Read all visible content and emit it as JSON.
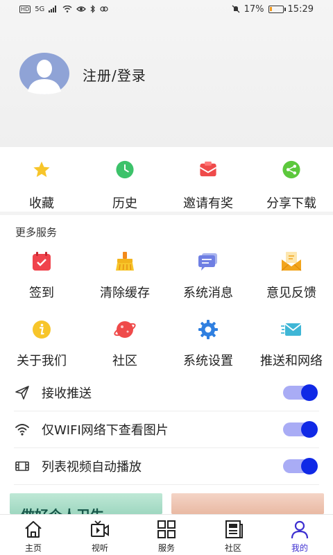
{
  "status_bar": {
    "left": "5G",
    "battery": "17%",
    "time": "15:29",
    "battery_level": 0.17
  },
  "profile": {
    "login_label": "注册/登录",
    "avatar_icon": "user-avatar-icon"
  },
  "quick": [
    {
      "label": "收藏",
      "icon": "star-icon",
      "color": "#f7c52a"
    },
    {
      "label": "历史",
      "icon": "clock-icon",
      "color": "#3cc26a"
    },
    {
      "label": "邀请有奖",
      "icon": "envelope-icon",
      "color": "#ef4a4a"
    },
    {
      "label": "分享下载",
      "icon": "share-icon",
      "color": "#5cc83c"
    }
  ],
  "more": {
    "title": "更多服务",
    "items": [
      {
        "label": "签到",
        "icon": "calendar-icon"
      },
      {
        "label": "清除缓存",
        "icon": "broom-icon"
      },
      {
        "label": "系统消息",
        "icon": "message-icon"
      },
      {
        "label": "意见反馈",
        "icon": "feedback-mail-icon"
      },
      {
        "label": "关于我们",
        "icon": "info-icon"
      },
      {
        "label": "社区",
        "icon": "planet-icon"
      },
      {
        "label": "系统设置",
        "icon": "gear-icon"
      },
      {
        "label": "推送和网络",
        "icon": "push-mail-icon"
      }
    ]
  },
  "settings": [
    {
      "label": "接收推送",
      "icon": "send-icon",
      "on": true
    },
    {
      "label": "仅WIFI网络下查看图片",
      "icon": "wifi-icon",
      "on": true
    },
    {
      "label": "列表视频自动播放",
      "icon": "film-icon",
      "on": true
    }
  ],
  "banner_a_text": "做好个人卫生",
  "tabs": [
    {
      "label": "主页",
      "icon": "home-icon"
    },
    {
      "label": "视听",
      "icon": "video-icon"
    },
    {
      "label": "服务",
      "icon": "grid-icon"
    },
    {
      "label": "社区",
      "icon": "newspaper-icon"
    },
    {
      "label": "我的",
      "icon": "person-icon",
      "active": true
    }
  ],
  "colors": {
    "accent": "#3d2fd0",
    "toggle_knob": "#1029e6",
    "toggle_track": "#a9acf5"
  }
}
